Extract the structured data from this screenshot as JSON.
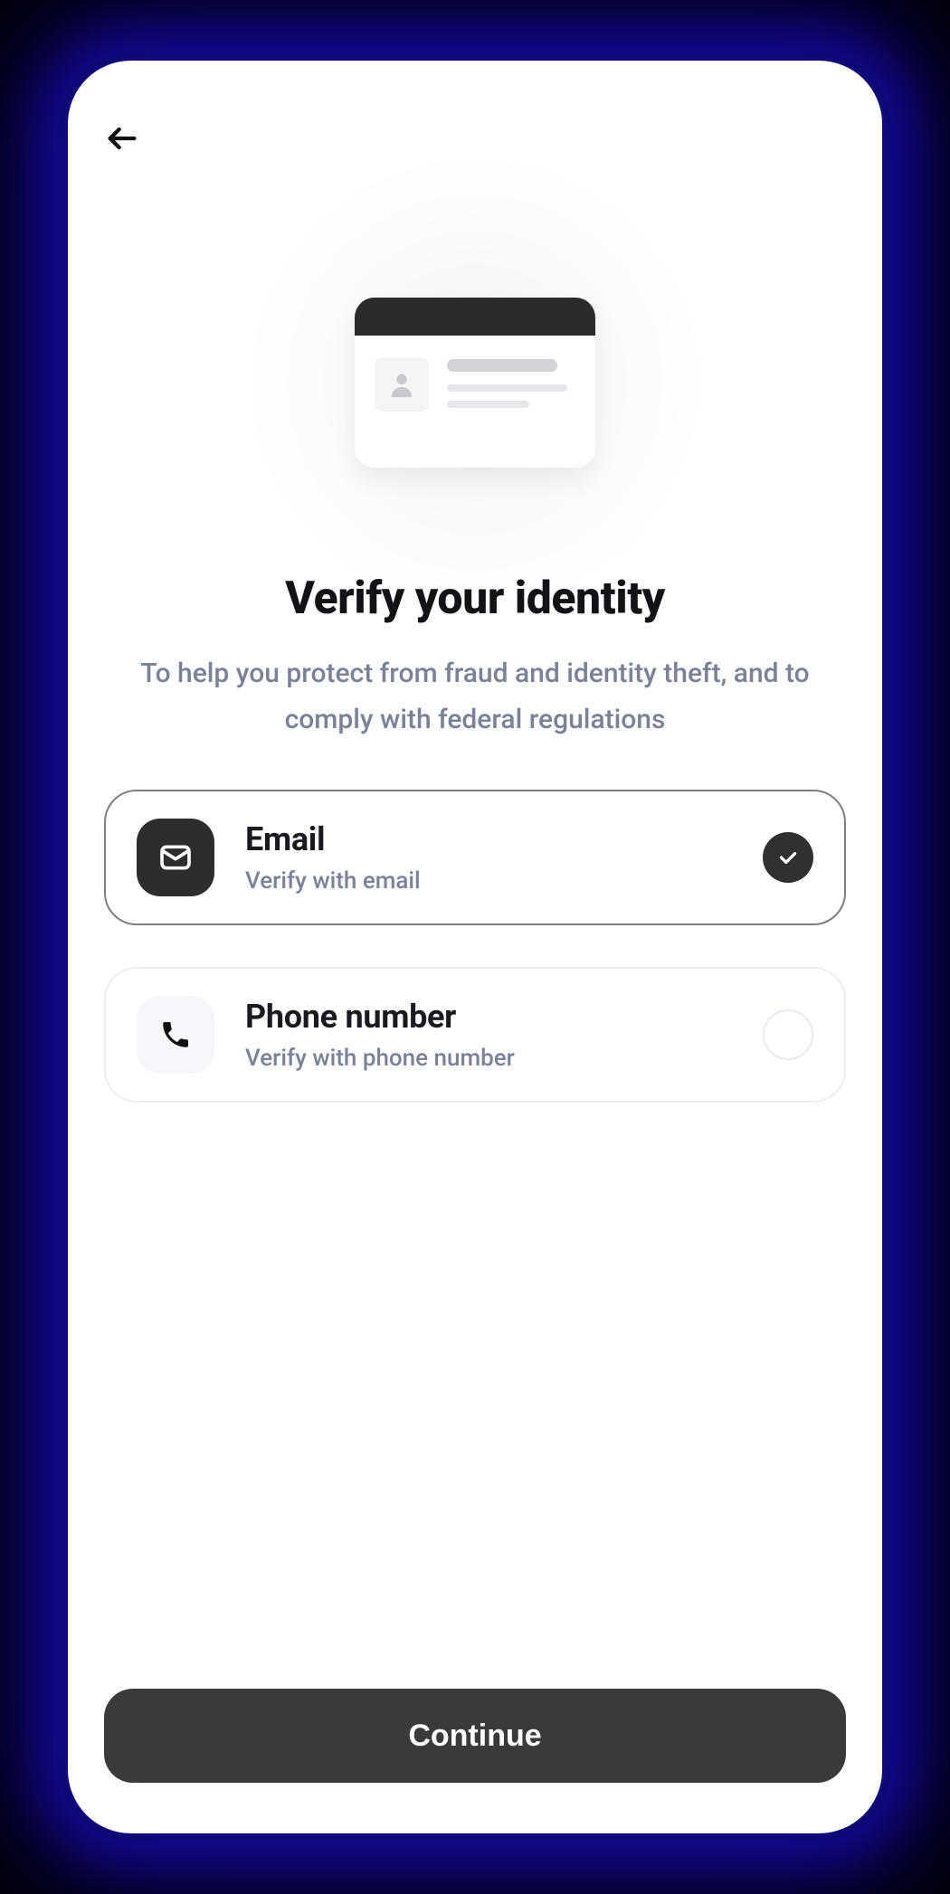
{
  "header": {
    "back_icon": "arrow-left-icon"
  },
  "illustration": {
    "kind": "id-card-illustration"
  },
  "title": "Verify your identity",
  "subtitle": "To help you protect from fraud and identity theft, and to comply with federal regulations",
  "options": [
    {
      "key": "email",
      "icon": "mail-icon",
      "title": "Email",
      "description": "Verify with email",
      "selected": true
    },
    {
      "key": "phone",
      "icon": "phone-icon",
      "title": "Phone number",
      "description": "Verify with phone number",
      "selected": false
    }
  ],
  "cta": {
    "continue_label": "Continue"
  },
  "colors": {
    "text_primary": "#121217",
    "text_secondary": "#7b8197",
    "surface": "#ffffff",
    "button": "#3a3a3c",
    "glow": "#1b0fb7"
  }
}
